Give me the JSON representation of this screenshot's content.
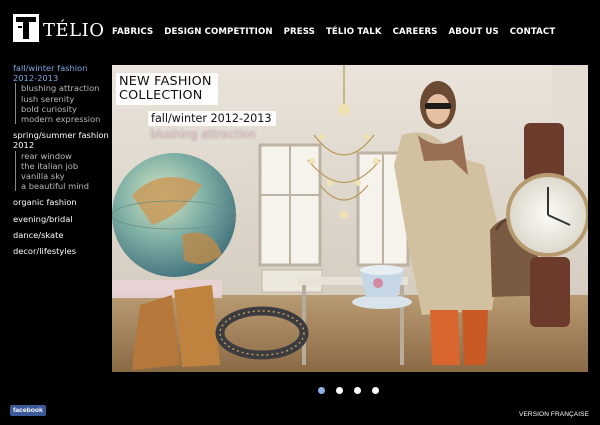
{
  "brand": {
    "name": "TÉLIO",
    "logo_icon": "telio-t-logo-icon"
  },
  "topnav": {
    "items": [
      {
        "label": "FABRICS",
        "active": true
      },
      {
        "label": "DESIGN COMPETITION"
      },
      {
        "label": "PRESS"
      },
      {
        "label": "TÉLIO TALK"
      },
      {
        "label": "CAREERS"
      },
      {
        "label": "ABOUT US"
      },
      {
        "label": "CONTACT"
      }
    ]
  },
  "sidebar": {
    "group1": {
      "title": "fall/winter fashion 2012-2013",
      "items": [
        "blushing attraction",
        "lush serenity",
        "bold curiosity",
        "modern expression"
      ]
    },
    "group2": {
      "title": "spring/summer fashion 2012",
      "items": [
        "rear window",
        "the italian job",
        "vanilla sky",
        "a beautiful mind"
      ]
    },
    "links": [
      "organic fashion",
      "evening/bridal",
      "dance/skate",
      "decor/lifestyles"
    ]
  },
  "hero": {
    "title": "NEW FASHION COLLECTION",
    "subtitle": "fall/winter 2012-2013",
    "collection": "blushing attraction"
  },
  "carousel": {
    "count": 4,
    "active_index": 0
  },
  "footer": {
    "facebook_label": "facebook",
    "version_label": "VERSION FRANÇAISE"
  },
  "colors": {
    "background": "#000000",
    "active_link": "#7ea6e0",
    "sub_link": "#b9b9b9",
    "dot_active": "#8fb0e8",
    "facebook": "#3b5998",
    "collection_text": "#e6c8cf"
  }
}
